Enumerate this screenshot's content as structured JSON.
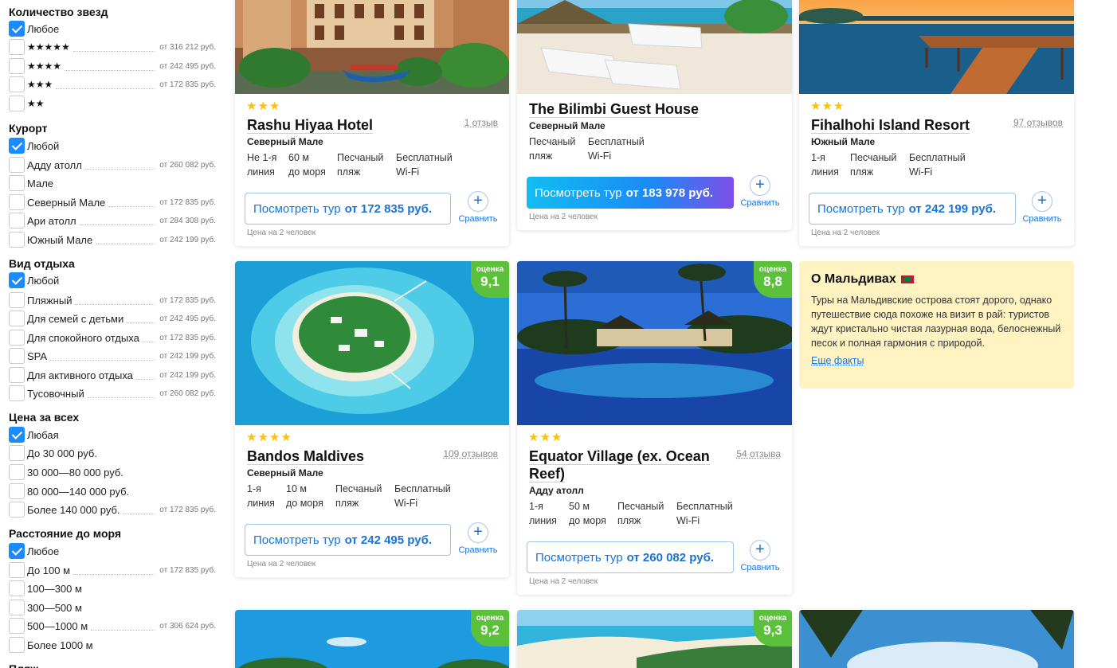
{
  "filters": [
    {
      "title": "Количество звезд",
      "options": [
        {
          "label": "Любое",
          "checked": true,
          "price": ""
        },
        {
          "label": "★★★★★",
          "checked": false,
          "price": "от 316 212 руб."
        },
        {
          "label": "★★★★",
          "checked": false,
          "price": "от 242 495 руб."
        },
        {
          "label": "★★★",
          "checked": false,
          "price": "от 172 835 руб."
        },
        {
          "label": "★★",
          "checked": false,
          "price": ""
        }
      ]
    },
    {
      "title": "Курорт",
      "options": [
        {
          "label": "Любой",
          "checked": true,
          "price": ""
        },
        {
          "label": "Адду атолл",
          "checked": false,
          "price": "от 260 082 руб."
        },
        {
          "label": "Мале",
          "checked": false,
          "price": ""
        },
        {
          "label": "Северный Мале",
          "checked": false,
          "price": "от 172 835 руб."
        },
        {
          "label": "Ари атолл",
          "checked": false,
          "price": "от 284 308 руб."
        },
        {
          "label": "Южный Мале",
          "checked": false,
          "price": "от 242 199 руб."
        }
      ]
    },
    {
      "title": "Вид отдыха",
      "options": [
        {
          "label": "Любой",
          "checked": true,
          "price": ""
        },
        {
          "label": "Пляжный",
          "checked": false,
          "price": "от 172 835 руб."
        },
        {
          "label": "Для семей с детьми",
          "checked": false,
          "price": "от 242 495 руб."
        },
        {
          "label": "Для спокойного отдыха",
          "checked": false,
          "price": "от 172 835 руб."
        },
        {
          "label": "SPA",
          "checked": false,
          "price": "от 242 199 руб."
        },
        {
          "label": "Для активного отдыха",
          "checked": false,
          "price": "от 242 199 руб."
        },
        {
          "label": "Тусовочный",
          "checked": false,
          "price": "от 260 082 руб."
        }
      ]
    },
    {
      "title": "Цена за всех",
      "options": [
        {
          "label": "Любая",
          "checked": true,
          "price": ""
        },
        {
          "label": "До 30 000 руб.",
          "checked": false,
          "price": ""
        },
        {
          "label": "30 000—80 000 руб.",
          "checked": false,
          "price": ""
        },
        {
          "label": "80 000—140 000 руб.",
          "checked": false,
          "price": ""
        },
        {
          "label": "Более 140 000 руб.",
          "checked": false,
          "price": "от 172 835 руб."
        }
      ]
    },
    {
      "title": "Расстояние до моря",
      "options": [
        {
          "label": "Любое",
          "checked": true,
          "price": ""
        },
        {
          "label": "До 100 м",
          "checked": false,
          "price": "от 172 835 руб."
        },
        {
          "label": "100—300 м",
          "checked": false,
          "price": ""
        },
        {
          "label": "300—500 м",
          "checked": false,
          "price": ""
        },
        {
          "label": "500—1000 м",
          "checked": false,
          "price": "от 306 624 руб."
        },
        {
          "label": "Более 1000 м",
          "checked": false,
          "price": ""
        }
      ]
    },
    {
      "title": "Пляж",
      "options": []
    }
  ],
  "hotels": [
    {
      "stars": "★★★",
      "name": "Rashu Hiyaa Hotel",
      "reviews": "1 отзыв",
      "region": "Северный Мале",
      "features": [
        "Не 1-я\nлиния",
        "60 м\nдо моря",
        "Песчаный\nпляж",
        "Бесплатный\nWi-Fi"
      ],
      "button_prefix": "Посмотреть тур",
      "price": "от 172 835 руб.",
      "compare": "Сравнить",
      "price_note": "Цена на 2 человек",
      "score_label": "",
      "score": ""
    },
    {
      "stars": "",
      "name": "The Bilimbi Guest House",
      "reviews": "",
      "region": "Северный Мале",
      "features": [
        "Песчаный\nпляж",
        "Бесплатный\nWi-Fi"
      ],
      "button_prefix": "Посмотреть тур",
      "price": "от 183 978 руб.",
      "compare": "Сравнить",
      "price_note": "Цена на 2 человек",
      "score_label": "",
      "score": ""
    },
    {
      "stars": "★★★",
      "name": "Fihalhohi Island Resort",
      "reviews": "97 отзывов",
      "region": "Южный Мале",
      "features": [
        "1-я\nлиния",
        "Песчаный\nпляж",
        "Бесплатный\nWi-Fi"
      ],
      "button_prefix": "Посмотреть тур",
      "price": "от 242 199 руб.",
      "compare": "Сравнить",
      "price_note": "Цена на 2 человек",
      "score_label": "",
      "score": ""
    },
    {
      "stars": "★★★★",
      "name": "Bandos Maldives",
      "reviews": "109 отзывов",
      "region": "Северный Мале",
      "features": [
        "1-я\nлиния",
        "10 м\nдо моря",
        "Песчаный\nпляж",
        "Бесплатный\nWi-Fi"
      ],
      "button_prefix": "Посмотреть тур",
      "price": "от 242 495 руб.",
      "compare": "Сравнить",
      "price_note": "Цена на 2 человек",
      "score_label": "оценка",
      "score": "9,1"
    },
    {
      "stars": "★★★",
      "name": "Equator Village (ex. Ocean\nReef)",
      "reviews": "54 отзыва",
      "region": "Адду атолл",
      "features": [
        "1-я\nлиния",
        "50 м\nдо моря",
        "Песчаный\nпляж",
        "Бесплатный\nWi-Fi"
      ],
      "button_prefix": "Посмотреть тур",
      "price": "от 260 082 руб.",
      "compare": "Сравнить",
      "price_note": "Цена на 2 человек",
      "score_label": "оценка",
      "score": "8,8"
    },
    {
      "score_label": "оценка",
      "score": "9,2"
    },
    {
      "score_label": "оценка",
      "score": "9,3"
    },
    {
      "score_label": "",
      "score": ""
    }
  ],
  "info": {
    "title": "О Мальдивах",
    "text": "Туры на Мальдивские острова стоят дорого, однако путешествие сюда похоже на визит в рай: туристов ждут кристально чистая лазурная вода, белоснежный песок и полная гармония с природой.",
    "link": "Еще факты"
  }
}
